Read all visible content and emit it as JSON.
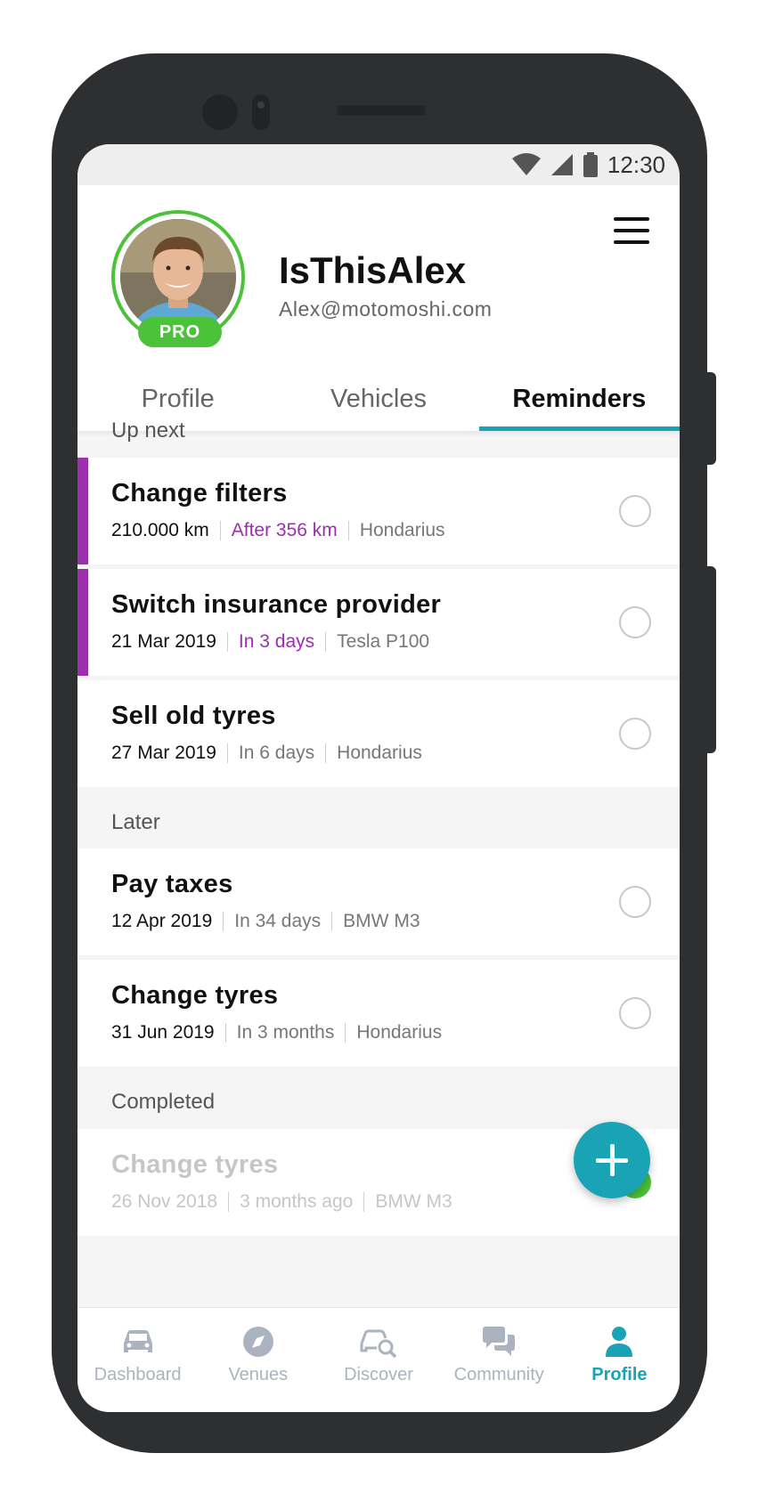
{
  "status_bar": {
    "time": "12:30"
  },
  "profile": {
    "username": "IsThisAlex",
    "email": "Alex@motomoshi.com",
    "badge": "PRO"
  },
  "tabs": [
    {
      "label": "Profile"
    },
    {
      "label": "Vehicles"
    },
    {
      "label": "Reminders",
      "active": true
    }
  ],
  "sections": {
    "up_next": "Up next",
    "later": "Later",
    "completed": "Completed"
  },
  "reminders": {
    "up_next": [
      {
        "title": "Change filters",
        "when": "210.000 km",
        "due": "After 356 km",
        "vehicle": "Hondarius",
        "urgent": true
      },
      {
        "title": "Switch insurance provider",
        "when": "21 Mar 2019",
        "due": "In 3 days",
        "vehicle": "Tesla P100",
        "urgent": true
      },
      {
        "title": "Sell old tyres",
        "when": "27 Mar 2019",
        "due": "In 6 days",
        "vehicle": "Hondarius",
        "urgent": false
      }
    ],
    "later": [
      {
        "title": "Pay taxes",
        "when": "12 Apr 2019",
        "due": "In 34 days",
        "vehicle": "BMW M3"
      },
      {
        "title": "Change tyres",
        "when": "31 Jun 2019",
        "due": "In 3 months",
        "vehicle": "Hondarius"
      }
    ],
    "completed": [
      {
        "title": "Change tyres",
        "when": "26 Nov 2018",
        "due": "3 months ago",
        "vehicle": "BMW M3"
      }
    ]
  },
  "bottom_nav": [
    {
      "label": "Dashboard",
      "icon": "car-icon"
    },
    {
      "label": "Venues",
      "icon": "compass-icon"
    },
    {
      "label": "Discover",
      "icon": "car-search-icon"
    },
    {
      "label": "Community",
      "icon": "chat-bubbles-icon"
    },
    {
      "label": "Profile",
      "icon": "person-icon",
      "active": true
    }
  ],
  "colors": {
    "accent": "#1aa3b4",
    "urgent": "#9b2fae",
    "pro_green": "#4cc13a",
    "device": "#2e2f31"
  }
}
